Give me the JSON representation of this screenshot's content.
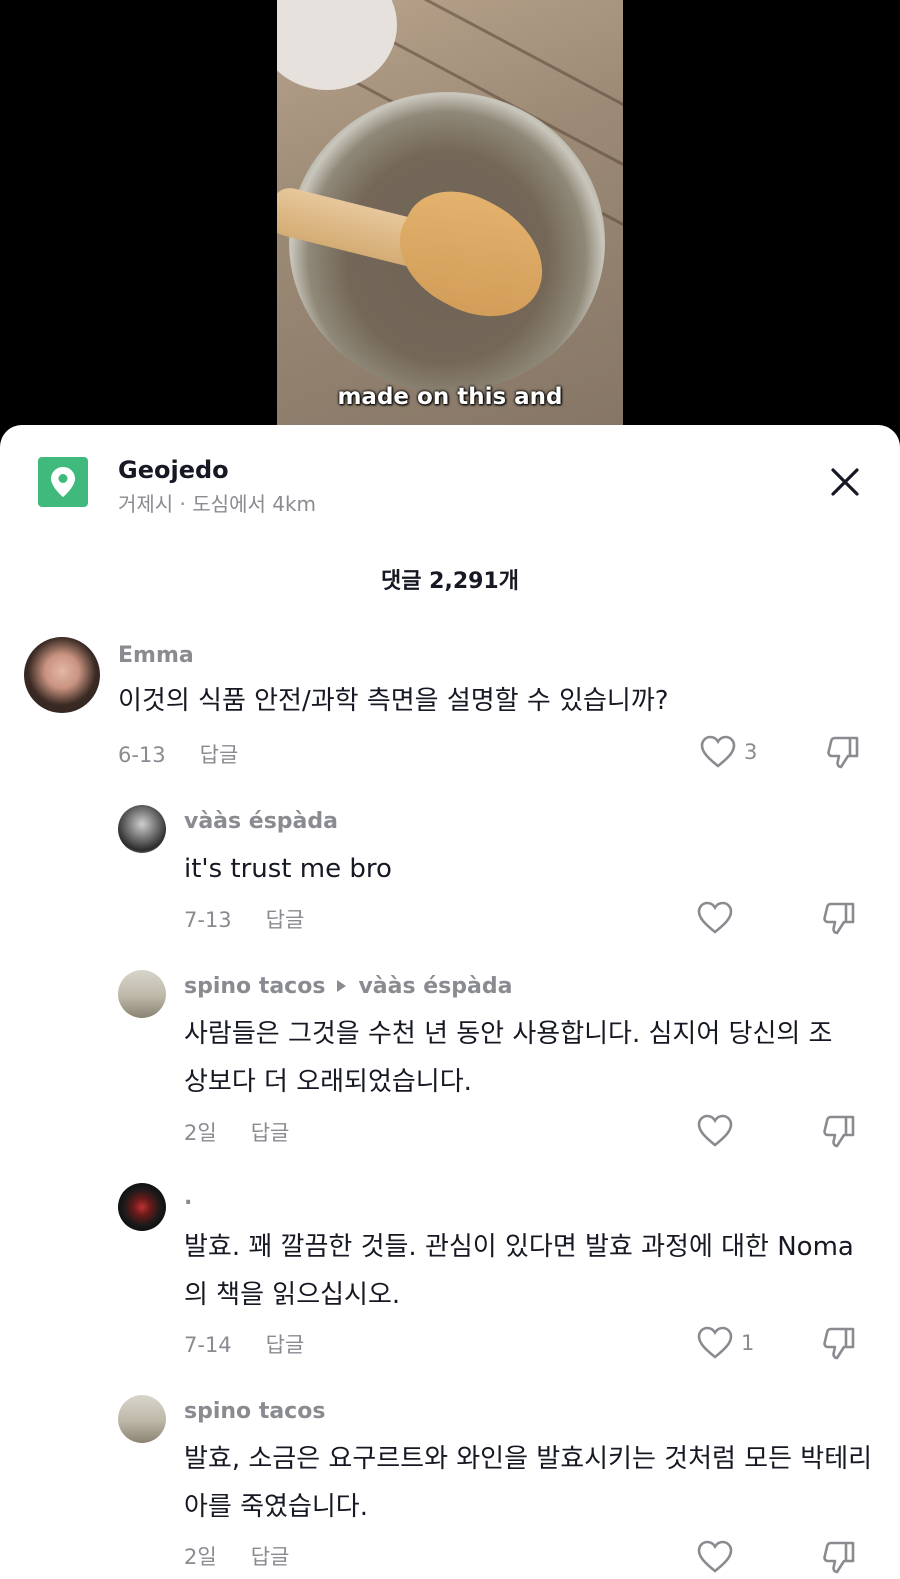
{
  "video": {
    "caption": "made on this and"
  },
  "location": {
    "title": "Geojedo",
    "subtitle": "거제시 · 도심에서 4km"
  },
  "comments_count": "댓글 2,291개",
  "reply_label": "답글",
  "comments": [
    {
      "username": "Emma",
      "text": "이것의 식품 안전/과학 측면을 설명할 수 있습니까?",
      "date": "6-13",
      "likes": "3"
    },
    {
      "username": "vààs éspàda",
      "text": "it's trust me bro",
      "date": "7-13",
      "likes": ""
    },
    {
      "username": "spino tacos",
      "reply_to": "vààs éspàda",
      "text": "사람들은 그것을 수천 년 동안 사용합니다. 심지어 당신의 조상보다 더 오래되었습니다.",
      "date": "2일",
      "likes": ""
    },
    {
      "username": ".",
      "text": "발효. 꽤 깔끔한 것들. 관심이 있다면 발효 과정에 대한 Noma의 책을 읽으십시오.",
      "date": "7-14",
      "likes": "1"
    },
    {
      "username": "spino tacos",
      "text": "발효, 소금은 요구르트와 와인을 발효시키는 것처럼 모든 박테리아를 죽였습니다.",
      "date": "2일",
      "likes": ""
    }
  ]
}
